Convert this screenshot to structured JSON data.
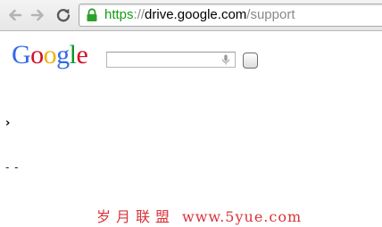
{
  "browser": {
    "url": {
      "scheme": "https",
      "separator": "://",
      "host": "drive.google.com",
      "path": "/support"
    },
    "colors": {
      "secure_scheme": "#149c14",
      "lock": "#2aa12a"
    },
    "icons": {
      "back": "back-arrow-icon",
      "forward": "forward-arrow-icon",
      "reload": "reload-icon",
      "lock": "lock-icon"
    }
  },
  "page": {
    "logo": {
      "letters": [
        "G",
        "o",
        "o",
        "g",
        "l",
        "e"
      ],
      "colors": [
        "#3369e8",
        "#d50f25",
        "#eeb211",
        "#3369e8",
        "#009925",
        "#d50f25"
      ]
    },
    "search": {
      "value": "",
      "mic_icon": "microphone-icon"
    },
    "chevron_text": "›",
    "dashes_text": "- -"
  },
  "watermark": {
    "chinese": "岁月联盟",
    "url": "www.5yue.com",
    "color": "#d8343a"
  }
}
